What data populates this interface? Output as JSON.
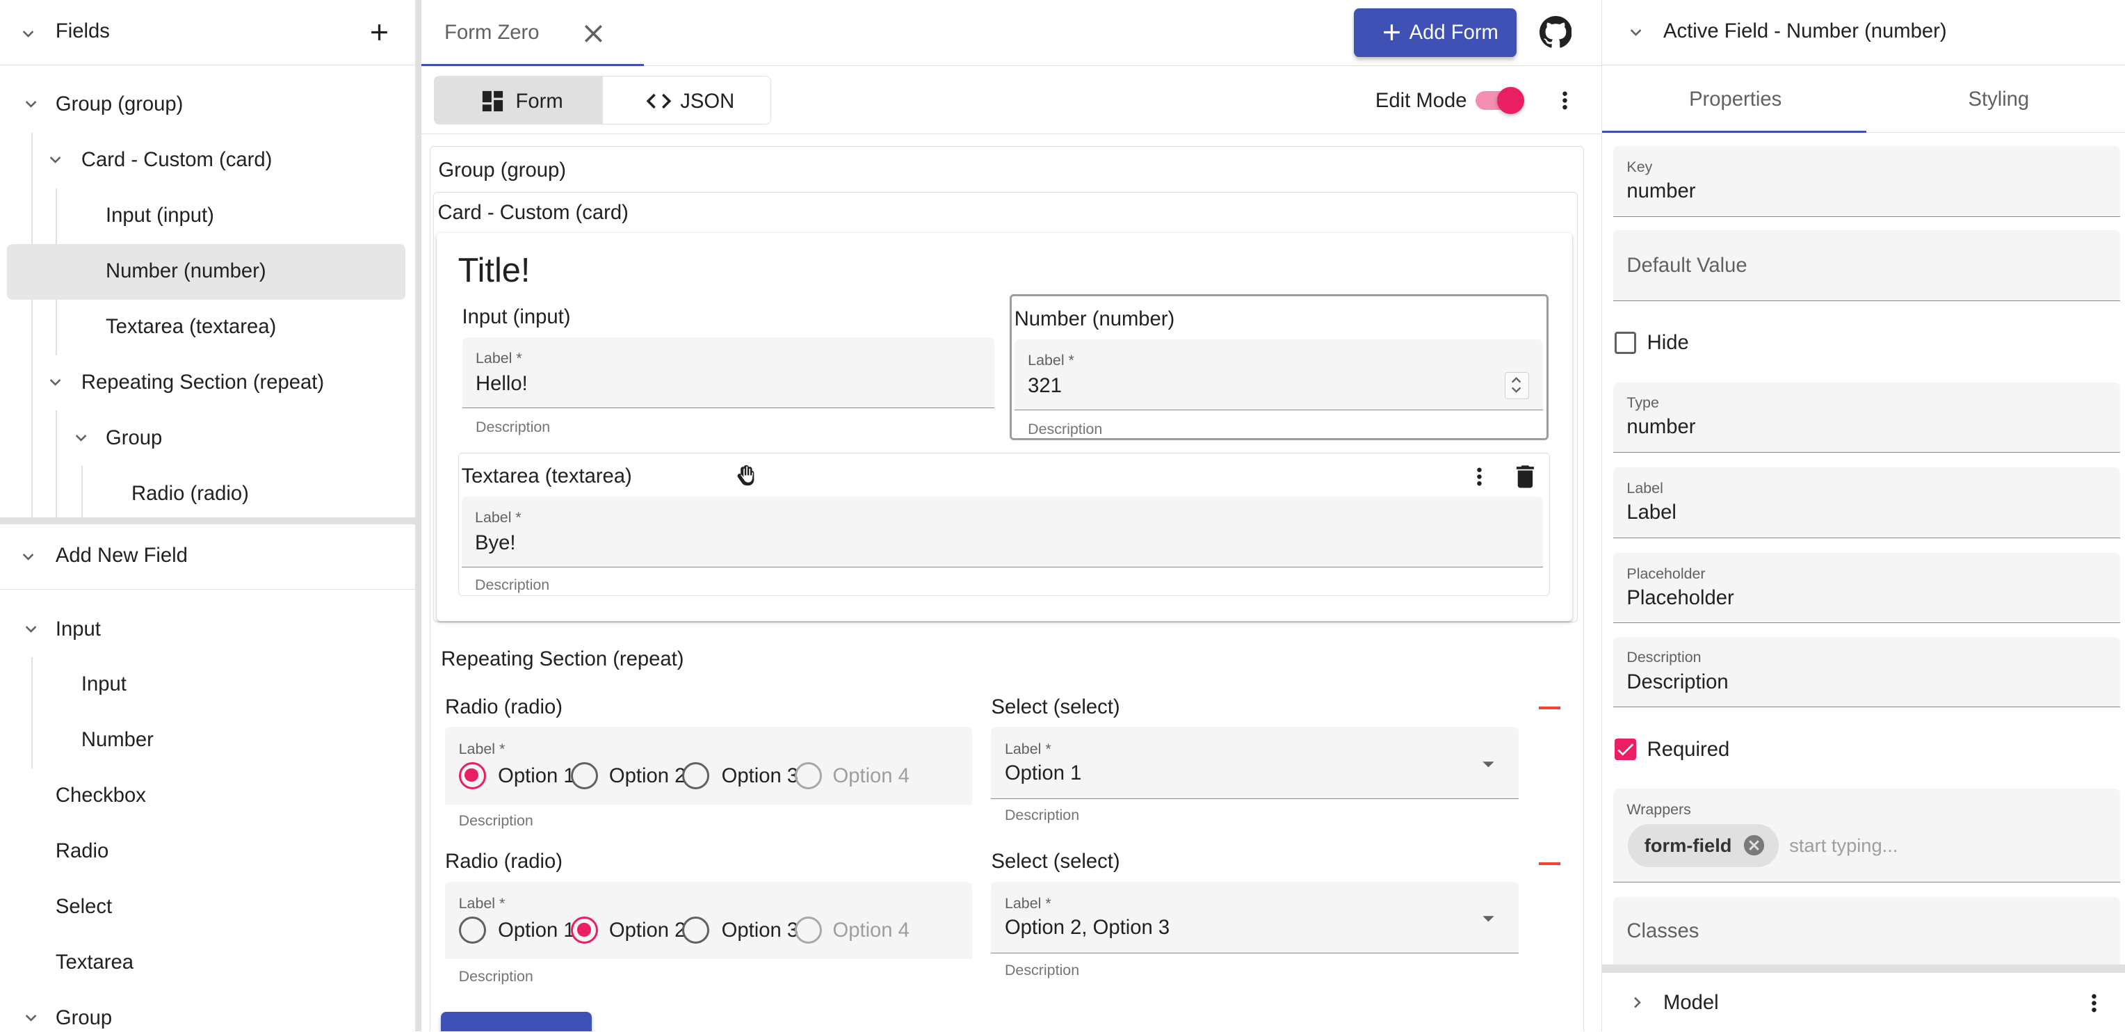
{
  "left": {
    "fields_title": "Fields",
    "tree": [
      {
        "label": "Group (group)"
      },
      {
        "label": "Card - Custom (card)"
      },
      {
        "label": "Input (input)"
      },
      {
        "label": "Number (number)"
      },
      {
        "label": "Textarea (textarea)"
      },
      {
        "label": "Repeating Section (repeat)"
      },
      {
        "label": "Group"
      },
      {
        "label": "Radio (radio)"
      }
    ],
    "add_title": "Add New Field",
    "add_items": [
      {
        "label": "Input"
      },
      {
        "label": "Input"
      },
      {
        "label": "Number"
      },
      {
        "label": "Checkbox"
      },
      {
        "label": "Radio"
      },
      {
        "label": "Select"
      },
      {
        "label": "Textarea"
      },
      {
        "label": "Group"
      }
    ]
  },
  "topbar": {
    "tab_label": "Form Zero",
    "add_form_label": "Add Form"
  },
  "toolbar": {
    "form_label": "Form",
    "json_label": "JSON",
    "edit_mode_label": "Edit Mode",
    "edit_mode_on": true
  },
  "canvas": {
    "group_label": "Group (group)",
    "card_label": "Card - Custom (card)",
    "card_title": "Title!",
    "input_field": {
      "header": "Input (input)",
      "label": "Label *",
      "value": "Hello!",
      "description": "Description"
    },
    "number_field": {
      "header": "Number (number)",
      "label": "Label *",
      "value": "321",
      "description": "Description"
    },
    "textarea_field": {
      "header": "Textarea (textarea)",
      "label": "Label *",
      "value": "Bye!",
      "description": "Description"
    },
    "repeat_label": "Repeating Section (repeat)",
    "rows": [
      {
        "radio_header": "Radio (radio)",
        "radio_label": "Label *",
        "options": [
          "Option 1",
          "Option 2",
          "Option 3",
          "Option 4"
        ],
        "selected": 0,
        "radio_description": "Description",
        "select_header": "Select (select)",
        "select_label": "Label *",
        "select_value": "Option 1",
        "select_description": "Description"
      },
      {
        "radio_header": "Radio (radio)",
        "radio_label": "Label *",
        "options": [
          "Option 1",
          "Option 2",
          "Option 3",
          "Option 4"
        ],
        "selected": 1,
        "radio_description": "Description",
        "select_header": "Select (select)",
        "select_label": "Label *",
        "select_value": "Option 2, Option 3",
        "select_description": "Description"
      }
    ]
  },
  "right": {
    "title": "Active Field - Number (number)",
    "tabs": [
      "Properties",
      "Styling"
    ],
    "key": {
      "label": "Key",
      "value": "number"
    },
    "default_value_placeholder": "Default Value",
    "hide_label": "Hide",
    "type": {
      "label": "Type",
      "value": "number"
    },
    "label_field": {
      "label": "Label",
      "value": "Label"
    },
    "placeholder_field": {
      "label": "Placeholder",
      "value": "Placeholder"
    },
    "description_field": {
      "label": "Description",
      "value": "Description"
    },
    "required_label": "Required",
    "required_checked": true,
    "wrappers": {
      "label": "Wrappers",
      "chip": "form-field",
      "placeholder": "start typing..."
    },
    "classes_placeholder": "Classes",
    "model_label": "Model"
  },
  "colors": {
    "primary": "#3f51b5",
    "accent": "#e91e63",
    "warn": "#f44336",
    "selected_row": "#e6e6e6",
    "field_fill": "#f5f5f5"
  }
}
